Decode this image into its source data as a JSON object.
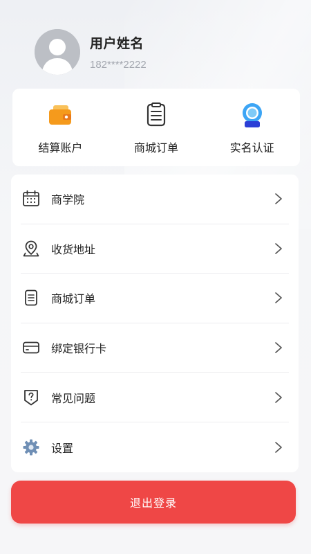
{
  "profile": {
    "name": "用户姓名",
    "phone": "182****2222"
  },
  "quick_actions": [
    {
      "label": "结算账户",
      "icon": "wallet-icon"
    },
    {
      "label": "商城订单",
      "icon": "order-list-icon"
    },
    {
      "label": "实名认证",
      "icon": "id-verify-icon"
    }
  ],
  "menu": [
    {
      "label": "商学院",
      "icon": "calendar-icon"
    },
    {
      "label": "收货地址",
      "icon": "location-pin-icon"
    },
    {
      "label": "商城订单",
      "icon": "document-icon"
    },
    {
      "label": "绑定银行卡",
      "icon": "card-icon"
    },
    {
      "label": "常见问题",
      "icon": "question-shield-icon"
    },
    {
      "label": "设置",
      "icon": "gear-icon"
    }
  ],
  "logout_label": "退出登录",
  "colors": {
    "accent": "#ef4746",
    "wallet_orange": "#f59a1c",
    "verify_blue": "#3ca5f5",
    "icon_stroke": "#333333",
    "gear_blue": "#6f8fb5"
  }
}
